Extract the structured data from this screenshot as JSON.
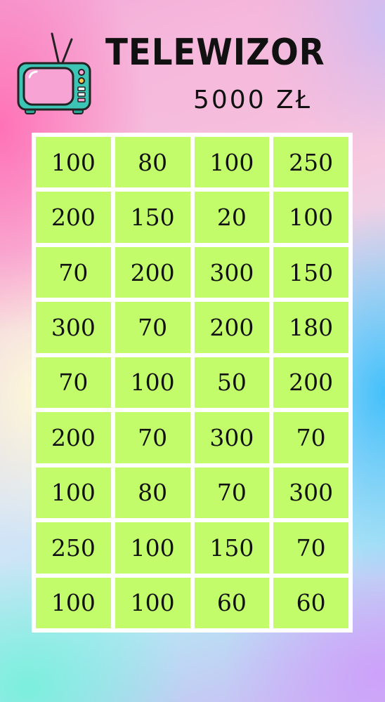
{
  "header": {
    "title": "TELEWIZOR",
    "prize": "5000 ZŁ",
    "icon": "tv-icon"
  },
  "colors": {
    "cell": "#c3fc6b",
    "board": "#ffffff",
    "text": "#111111",
    "tv_body": "#3cc4b4",
    "tv_screen": "#f7a3d3"
  },
  "board": {
    "rows": [
      [
        "100",
        "80",
        "100",
        "250"
      ],
      [
        "200",
        "150",
        "20",
        "100"
      ],
      [
        "70",
        "200",
        "300",
        "150"
      ],
      [
        "300",
        "70",
        "200",
        "180"
      ],
      [
        "70",
        "100",
        "50",
        "200"
      ],
      [
        "200",
        "70",
        "300",
        "70"
      ],
      [
        "100",
        "80",
        "70",
        "300"
      ],
      [
        "250",
        "100",
        "150",
        "70"
      ],
      [
        "100",
        "100",
        "60",
        "60"
      ]
    ]
  }
}
